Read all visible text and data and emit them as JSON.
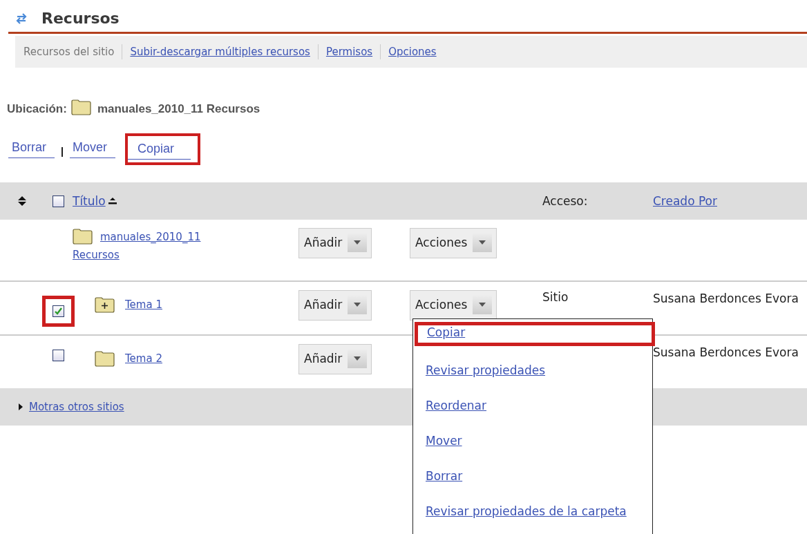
{
  "page": {
    "title": "Recursos"
  },
  "toolbar": [
    {
      "label": "Recursos del sitio",
      "selected": true
    },
    {
      "label": "Subir-descargar múltiples recursos",
      "selected": false
    },
    {
      "label": "Permisos",
      "selected": false
    },
    {
      "label": "Opciones",
      "selected": false
    }
  ],
  "location": {
    "label": "Ubicación:",
    "path": "manuales_2010_11 Recursos"
  },
  "actions": [
    {
      "label": "Borrar",
      "highlighted": false
    },
    {
      "label": "Mover",
      "highlighted": false
    },
    {
      "label": "Copiar",
      "highlighted": true
    }
  ],
  "table": {
    "select_all": {
      "checked": false
    },
    "columns": [
      {
        "label": "Título",
        "kind": "link"
      },
      {
        "label": "Acceso:",
        "kind": "plain"
      },
      {
        "label": "Creado Por",
        "kind": "link"
      }
    ],
    "rows": [
      {
        "kind": "root",
        "title": "manuales_2010_11 Recursos",
        "add_button": "Añadir",
        "actions_button": "Acciones"
      },
      {
        "kind": "folder",
        "expandable": true,
        "checked": true,
        "highlighted": true,
        "title": "Tema 1",
        "add_button": "Añadir",
        "actions_button": "Acciones",
        "access": "Sitio",
        "created_by": "Susana Berdonces Evora",
        "actions_menu": [
          {
            "label": "Copiar",
            "highlighted": true
          },
          {
            "label": "Revisar propiedades",
            "highlighted": false
          },
          {
            "label": "Reordenar",
            "highlighted": false
          },
          {
            "label": "Mover",
            "highlighted": false
          },
          {
            "label": "Borrar",
            "highlighted": false
          },
          {
            "label": "Revisar propiedades de la carpeta",
            "highlighted": false
          }
        ]
      },
      {
        "kind": "folder",
        "expandable": false,
        "checked": false,
        "highlighted": false,
        "title": "Tema 2",
        "add_button": "Añadir",
        "created_by": "Susana Berdonces Evora"
      }
    ],
    "footer": {
      "label": "Motras otros sitios",
      "expanded": false
    }
  }
}
